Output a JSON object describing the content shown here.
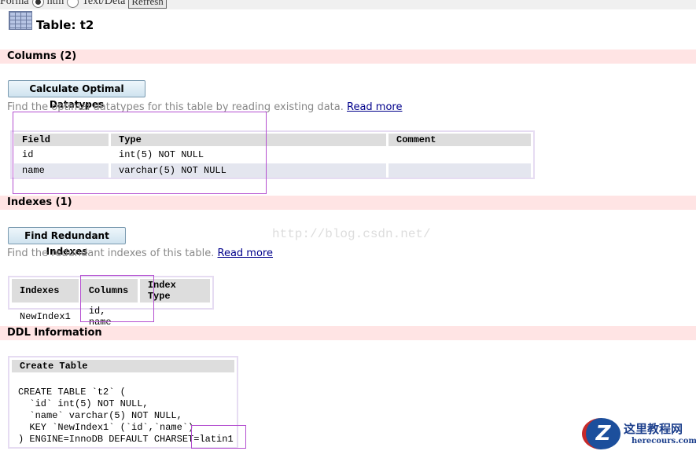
{
  "toolbar": {
    "format_label": "Forma",
    "opt_html": "htm",
    "opt_text": "Text/Deta",
    "refresh": "Refresh"
  },
  "title": "Table: t2",
  "columns": {
    "heading": "Columns (2)",
    "button": "Calculate Optimal Datatypes",
    "desc": "Find the optimal datatypes for this table by reading existing data.",
    "link": "Read more",
    "headers": [
      "Field",
      "Type",
      "Comment"
    ],
    "rows": [
      [
        "id",
        "int(5) NOT NULL",
        ""
      ],
      [
        "name",
        "varchar(5) NOT NULL",
        ""
      ]
    ]
  },
  "indexes": {
    "heading": "Indexes (1)",
    "button": "Find Redundant Indexes",
    "desc": "Find the redundant indexes of this table.",
    "link": "Read more",
    "headers": [
      "Indexes",
      "Columns",
      "Index Type"
    ],
    "rows": [
      [
        "NewIndex1",
        "id, name",
        ""
      ]
    ]
  },
  "ddl": {
    "heading": "DDL Information",
    "header": "Create Table",
    "code": "CREATE TABLE `t2` (\n  `id` int(5) NOT NULL,\n  `name` varchar(5) NOT NULL,\n  KEY `NewIndex1` (`id`,`name`)\n) ENGINE=InnoDB DEFAULT CHARSET=latin1"
  },
  "watermark": "http://blog.csdn.net/",
  "logo": {
    "cn": "这里教程网",
    "en": "herecours.com"
  }
}
